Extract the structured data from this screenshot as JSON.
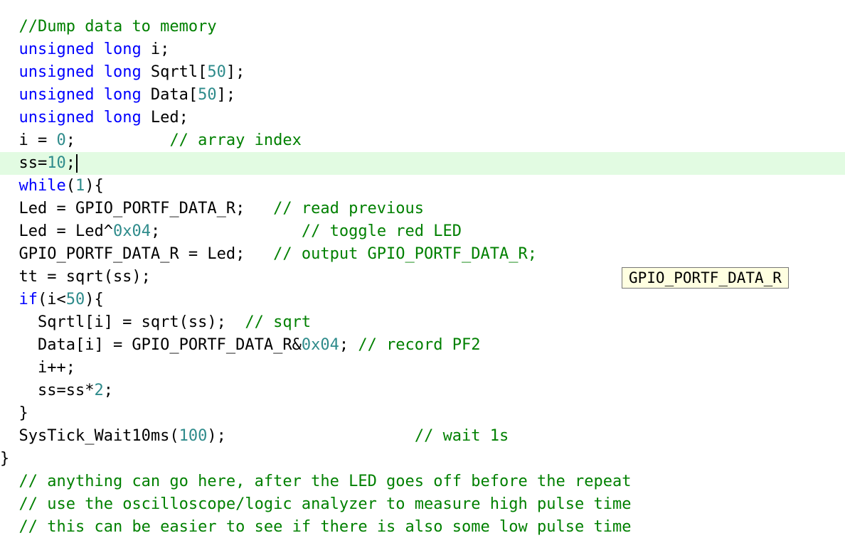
{
  "editor": {
    "colors": {
      "keyword": "#0000ff",
      "comment": "#008000",
      "number": "#2e8b8b",
      "text": "#000000",
      "current_line_bg": "#e2fbe2"
    },
    "current_line_index": 6,
    "lines": [
      [
        [
          "  ",
          "p"
        ],
        [
          "//Dump data to memory",
          "c"
        ]
      ],
      [
        [
          "  ",
          "p"
        ],
        [
          "unsigned long",
          "k"
        ],
        [
          " i;",
          "p"
        ]
      ],
      [
        [
          "  ",
          "p"
        ],
        [
          "unsigned long",
          "k"
        ],
        [
          " Sqrtl[",
          "p"
        ],
        [
          "50",
          "n"
        ],
        [
          "];",
          "p"
        ]
      ],
      [
        [
          "  ",
          "p"
        ],
        [
          "unsigned long",
          "k"
        ],
        [
          " Data[",
          "p"
        ],
        [
          "50",
          "n"
        ],
        [
          "];",
          "p"
        ]
      ],
      [
        [
          "  ",
          "p"
        ],
        [
          "unsigned long",
          "k"
        ],
        [
          " Led;",
          "p"
        ]
      ],
      [
        [
          "  i = ",
          "p"
        ],
        [
          "0",
          "n"
        ],
        [
          ";          ",
          "p"
        ],
        [
          "// array index",
          "c"
        ]
      ],
      [
        [
          "  ss=",
          "p"
        ],
        [
          "10",
          "n"
        ],
        [
          ";",
          "p"
        ]
      ],
      [
        [
          "  ",
          "p"
        ],
        [
          "while",
          "k"
        ],
        [
          "(",
          "p"
        ],
        [
          "1",
          "n"
        ],
        [
          "){",
          "p"
        ]
      ],
      [
        [
          "  Led = GPIO_PORTF_DATA_R;   ",
          "p"
        ],
        [
          "// read previous",
          "c"
        ]
      ],
      [
        [
          "  Led = Led^",
          "p"
        ],
        [
          "0x04",
          "n"
        ],
        [
          ";               ",
          "p"
        ],
        [
          "// toggle red LED",
          "c"
        ]
      ],
      [
        [
          "  GPIO_PORTF_DATA_R = Led;   ",
          "p"
        ],
        [
          "// output GPIO_PORTF_DATA_R;",
          "c"
        ]
      ],
      [
        [
          "  tt = sqrt(ss);",
          "p"
        ]
      ],
      [
        [
          "  ",
          "p"
        ],
        [
          "if",
          "k"
        ],
        [
          "(i<",
          "p"
        ],
        [
          "50",
          "n"
        ],
        [
          "){",
          "p"
        ]
      ],
      [
        [
          "    Sqrtl[i] = sqrt(ss);  ",
          "p"
        ],
        [
          "// sqrt",
          "c"
        ]
      ],
      [
        [
          "    Data[i] = GPIO_PORTF_DATA_R&",
          "p"
        ],
        [
          "0x04",
          "n"
        ],
        [
          "; ",
          "p"
        ],
        [
          "// record PF2",
          "c"
        ]
      ],
      [
        [
          "    i++;",
          "p"
        ]
      ],
      [
        [
          "    ss=ss*",
          "p"
        ],
        [
          "2",
          "n"
        ],
        [
          ";",
          "p"
        ]
      ],
      [
        [
          "  }",
          "p"
        ]
      ],
      [
        [
          "  SysTick_Wait10ms(",
          "p"
        ],
        [
          "100",
          "n"
        ],
        [
          ");                    ",
          "p"
        ],
        [
          "// wait 1s",
          "c"
        ]
      ],
      [
        [
          "}",
          "p"
        ]
      ],
      [
        [
          "  ",
          "p"
        ],
        [
          "// anything can go here, after the LED goes off before the repeat",
          "c"
        ]
      ],
      [
        [
          "  ",
          "p"
        ],
        [
          "// use the oscilloscope/logic analyzer to measure high pulse time",
          "c"
        ]
      ],
      [
        [
          "  ",
          "p"
        ],
        [
          "// this can be easier to see if there is also some low pulse time",
          "c"
        ]
      ]
    ]
  },
  "tooltip": {
    "text": "GPIO_PORTF_DATA_R"
  }
}
